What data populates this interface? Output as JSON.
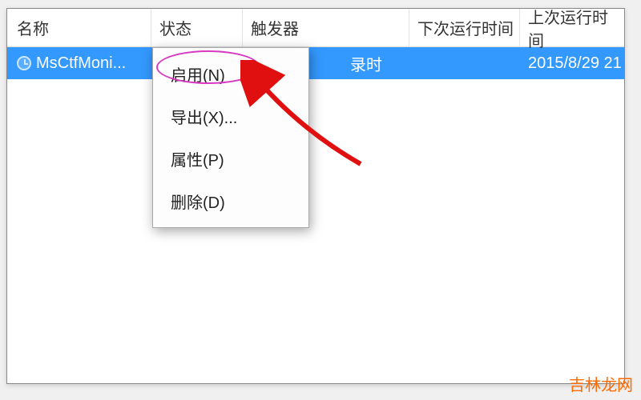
{
  "columns": {
    "name": "名称",
    "status": "状态",
    "trigger": "触发器",
    "nextRun": "下次运行时间",
    "lastRun": "上次运行时间"
  },
  "row": {
    "name": "MsCtfMoni...",
    "triggerVisible": "录时",
    "lastRun": "2015/8/29 21"
  },
  "contextMenu": {
    "enable": "启用(N)",
    "export": "导出(X)...",
    "properties": "属性(P)",
    "delete": "删除(D)"
  },
  "watermark": "吉林龙网"
}
